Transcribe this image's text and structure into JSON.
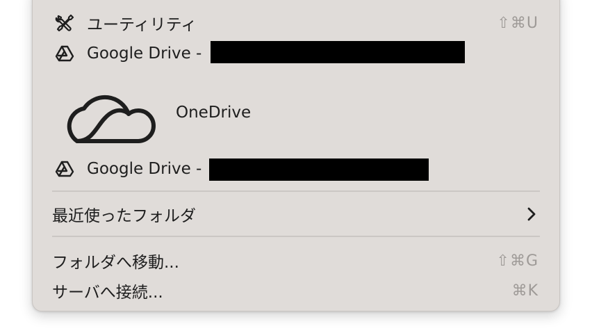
{
  "menu": {
    "items": [
      {
        "label": "ユーティリティ",
        "icon": "tools-icon",
        "shortcut": "⇧⌘U"
      },
      {
        "label": "Google Drive -",
        "icon": "google-drive-icon",
        "redacted": true
      },
      {
        "label": "OneDrive",
        "icon": "onedrive-cloud-icon"
      },
      {
        "label": "Google Drive -",
        "icon": "google-drive-icon",
        "redacted": true
      }
    ],
    "recent_folders": {
      "label": "最近使ったフォルダ",
      "icon": "chevron-right-icon"
    },
    "goto_folder": {
      "label": "フォルダへ移動...",
      "shortcut": "⇧⌘G"
    },
    "connect_server": {
      "label": "サーバへ接続...",
      "shortcut": "⌘K"
    }
  },
  "colors": {
    "menu_background": "#e0dcd9",
    "text": "#1e1e1e",
    "shortcut_text": "#9e9a97",
    "separator": "#cbc7c4",
    "redaction": "#000000"
  }
}
